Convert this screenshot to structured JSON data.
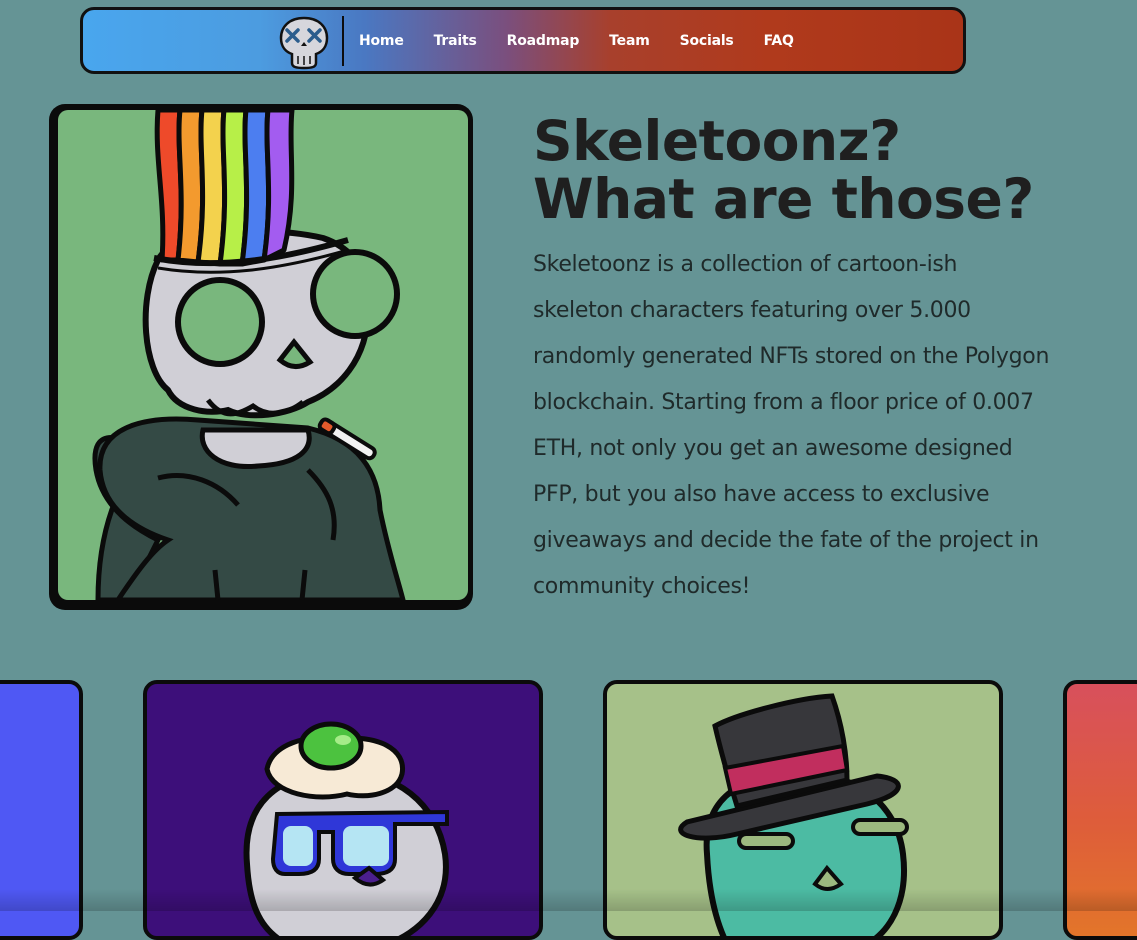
{
  "nav": {
    "logo_icon": "skull-logo-icon",
    "links": [
      {
        "label": "Home"
      },
      {
        "label": "Traits"
      },
      {
        "label": "Roadmap"
      },
      {
        "label": "Team"
      },
      {
        "label": "Socials"
      },
      {
        "label": "FAQ"
      }
    ]
  },
  "hero": {
    "title_line1": "Skeletoonz?",
    "title_line2": "What are those?",
    "description": "Skeletoonz is a collection of cartoon-ish skeleton characters featuring over 5.000 randomly generated NFTs stored on the Polygon blockchain. Starting from a floor price of 0.007 ETH, not only you get an awesome designed PFP, but you also have access to exclusive giveaways and decide the fate of the project in community choices!"
  },
  "colors": {
    "page_bg": "#659495",
    "hero_card_bg": "#79b77d",
    "card_blue": "#4f58f4",
    "card_purple": "#3d0f7a",
    "card_green": "#a6c189",
    "card_orange": "#de5d3a"
  }
}
